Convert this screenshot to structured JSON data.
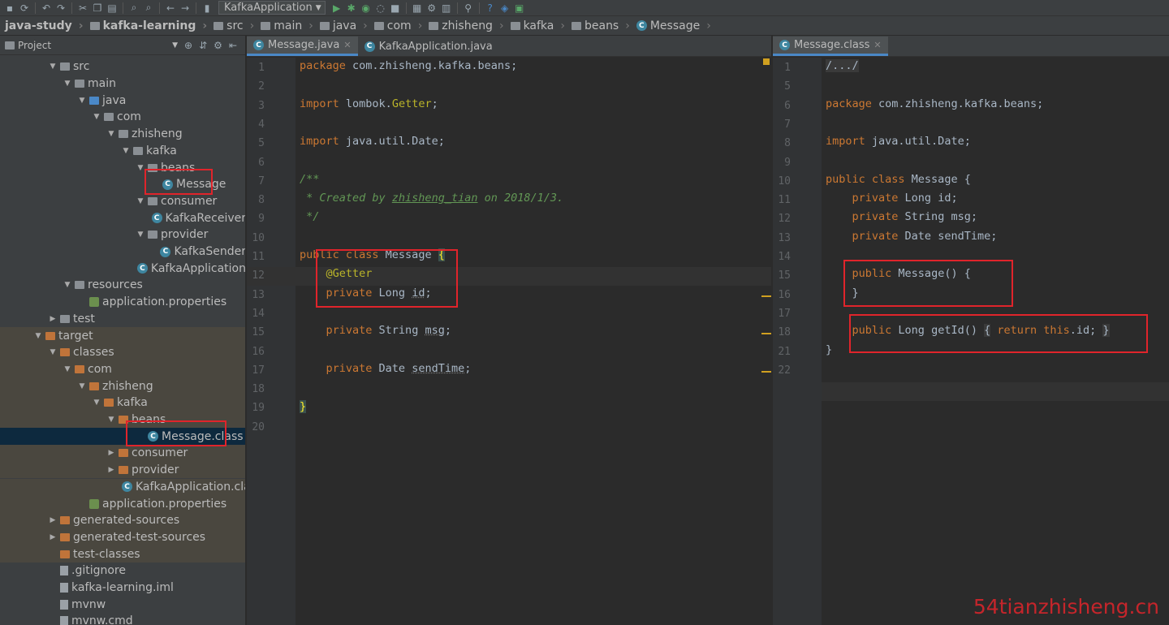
{
  "run_config": {
    "label": "KafkaApplication"
  },
  "breadcrumb": [
    "java-study",
    "kafka-learning",
    "src",
    "main",
    "java",
    "com",
    "zhisheng",
    "kafka",
    "beans",
    "Message"
  ],
  "sidebar": {
    "title": "Project",
    "items": [
      {
        "label": "src",
        "arrow": "▼",
        "icon": "folder"
      },
      {
        "label": "main",
        "arrow": "▼",
        "icon": "folder"
      },
      {
        "label": "java",
        "arrow": "▼",
        "icon": "folder-blue"
      },
      {
        "label": "com",
        "arrow": "▼",
        "icon": "folder"
      },
      {
        "label": "zhisheng",
        "arrow": "▼",
        "icon": "folder"
      },
      {
        "label": "kafka",
        "arrow": "▼",
        "icon": "folder"
      },
      {
        "label": "beans",
        "arrow": "▼",
        "icon": "folder"
      },
      {
        "label": "Message",
        "arrow": "",
        "icon": "class"
      },
      {
        "label": "consumer",
        "arrow": "▼",
        "icon": "folder"
      },
      {
        "label": "KafkaReceiver",
        "arrow": "",
        "icon": "class"
      },
      {
        "label": "provider",
        "arrow": "▼",
        "icon": "folder"
      },
      {
        "label": "KafkaSender",
        "arrow": "",
        "icon": "class"
      },
      {
        "label": "KafkaApplication",
        "arrow": "",
        "icon": "class"
      },
      {
        "label": "resources",
        "arrow": "▼",
        "icon": "folder"
      },
      {
        "label": "application.properties",
        "arrow": "",
        "icon": "properties"
      },
      {
        "label": "test",
        "arrow": "▶",
        "icon": "folder"
      },
      {
        "label": "target",
        "arrow": "▼",
        "icon": "folder-orange"
      },
      {
        "label": "classes",
        "arrow": "▼",
        "icon": "folder-orange"
      },
      {
        "label": "com",
        "arrow": "▼",
        "icon": "folder-orange"
      },
      {
        "label": "zhisheng",
        "arrow": "▼",
        "icon": "folder-orange"
      },
      {
        "label": "kafka",
        "arrow": "▼",
        "icon": "folder-orange"
      },
      {
        "label": "beans",
        "arrow": "▼",
        "icon": "folder-orange"
      },
      {
        "label": "Message.class",
        "arrow": "",
        "icon": "class"
      },
      {
        "label": "consumer",
        "arrow": "▶",
        "icon": "folder-orange"
      },
      {
        "label": "provider",
        "arrow": "▶",
        "icon": "folder-orange"
      },
      {
        "label": "KafkaApplication.class",
        "arrow": "",
        "icon": "class"
      },
      {
        "label": "application.properties",
        "arrow": "",
        "icon": "properties"
      },
      {
        "label": "generated-sources",
        "arrow": "▶",
        "icon": "folder-orange"
      },
      {
        "label": "generated-test-sources",
        "arrow": "▶",
        "icon": "folder-orange"
      },
      {
        "label": "test-classes",
        "arrow": "",
        "icon": "folder-orange"
      },
      {
        "label": ".gitignore",
        "arrow": "",
        "icon": "file"
      },
      {
        "label": "kafka-learning.iml",
        "arrow": "",
        "icon": "file"
      },
      {
        "label": "mvnw",
        "arrow": "",
        "icon": "file"
      },
      {
        "label": "mvnw.cmd",
        "arrow": "",
        "icon": "file"
      }
    ]
  },
  "left_editor": {
    "tabs": [
      {
        "label": "Message.java"
      },
      {
        "label": "KafkaApplication.java"
      }
    ],
    "line_numbers": [
      "1",
      "2",
      "3",
      "4",
      "5",
      "6",
      "7",
      "8",
      "9",
      "10",
      "11",
      "12",
      "13",
      "14",
      "15",
      "16",
      "17",
      "18",
      "19",
      "20"
    ]
  },
  "right_editor": {
    "tabs": [
      {
        "label": "Message.class"
      }
    ],
    "line_numbers": [
      "1",
      "5",
      "6",
      "7",
      "8",
      "9",
      "10",
      "11",
      "12",
      "13",
      "14",
      "15",
      "16",
      "17",
      "18",
      "21",
      "22"
    ]
  },
  "watermark": "54tianzhisheng.cn",
  "colors": {
    "keyword": "#cc7832",
    "comment": "#629755",
    "annotation": "#bbb529",
    "highlight_box": "#e0242b",
    "selection": "#0d293e"
  }
}
